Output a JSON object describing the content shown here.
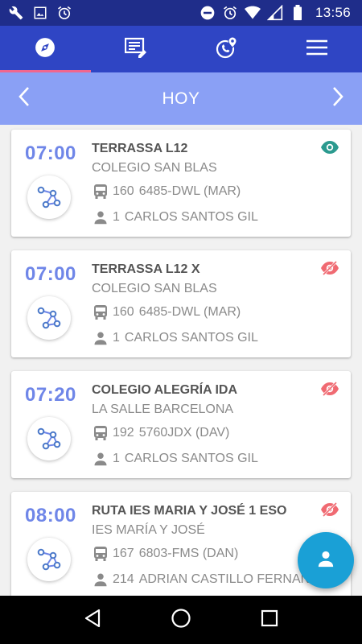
{
  "status_bar": {
    "time": "13:56"
  },
  "header": {
    "tabs": [
      {
        "name": "explore",
        "icon": "compass-icon",
        "active": true
      },
      {
        "name": "messages",
        "icon": "message-edit-icon",
        "active": false
      },
      {
        "name": "calls",
        "icon": "phone-location-icon",
        "active": false
      },
      {
        "name": "menu",
        "icon": "hamburger-icon",
        "active": false
      }
    ]
  },
  "date_bar": {
    "title": "HOY"
  },
  "routes": [
    {
      "time": "07:00",
      "title": "TERRASSA L12",
      "subtitle": "COLEGIO SAN BLAS",
      "bus_number": "160",
      "plate": "6485-DWL (MAR)",
      "passengers": "1",
      "driver": "CARLOS SANTOS GIL",
      "visible": true
    },
    {
      "time": "07:00",
      "title": "TERRASSA L12 X",
      "subtitle": "COLEGIO SAN BLAS",
      "bus_number": "160",
      "plate": "6485-DWL (MAR)",
      "passengers": "1",
      "driver": "CARLOS SANTOS GIL",
      "visible": false
    },
    {
      "time": "07:20",
      "title": "COLEGIO ALEGRÍA IDA",
      "subtitle": "LA SALLE BARCELONA",
      "bus_number": "192",
      "plate": "5760JDX (DAV)",
      "passengers": "1",
      "driver": "CARLOS SANTOS GIL",
      "visible": false
    },
    {
      "time": "08:00",
      "title": "RUTA IES MARIA Y JOSÉ 1 ESO",
      "subtitle": "IES MARÍA Y JOSÉ",
      "bus_number": "167",
      "plate": "6803-FMS (DAN)",
      "passengers": "214",
      "driver": "ADRIAN CASTILLO FERNAN",
      "visible": false
    }
  ],
  "colors": {
    "status_bar": "#1f2d8a",
    "tab_bar": "#2f45c4",
    "tab_indicator": "#f0668f",
    "date_bar": "#8aa0f5",
    "time_text": "#6f86e8",
    "eye_visible": "#2b9a8f",
    "eye_hidden": "#f06a72",
    "fab": "#1aa0d6"
  }
}
